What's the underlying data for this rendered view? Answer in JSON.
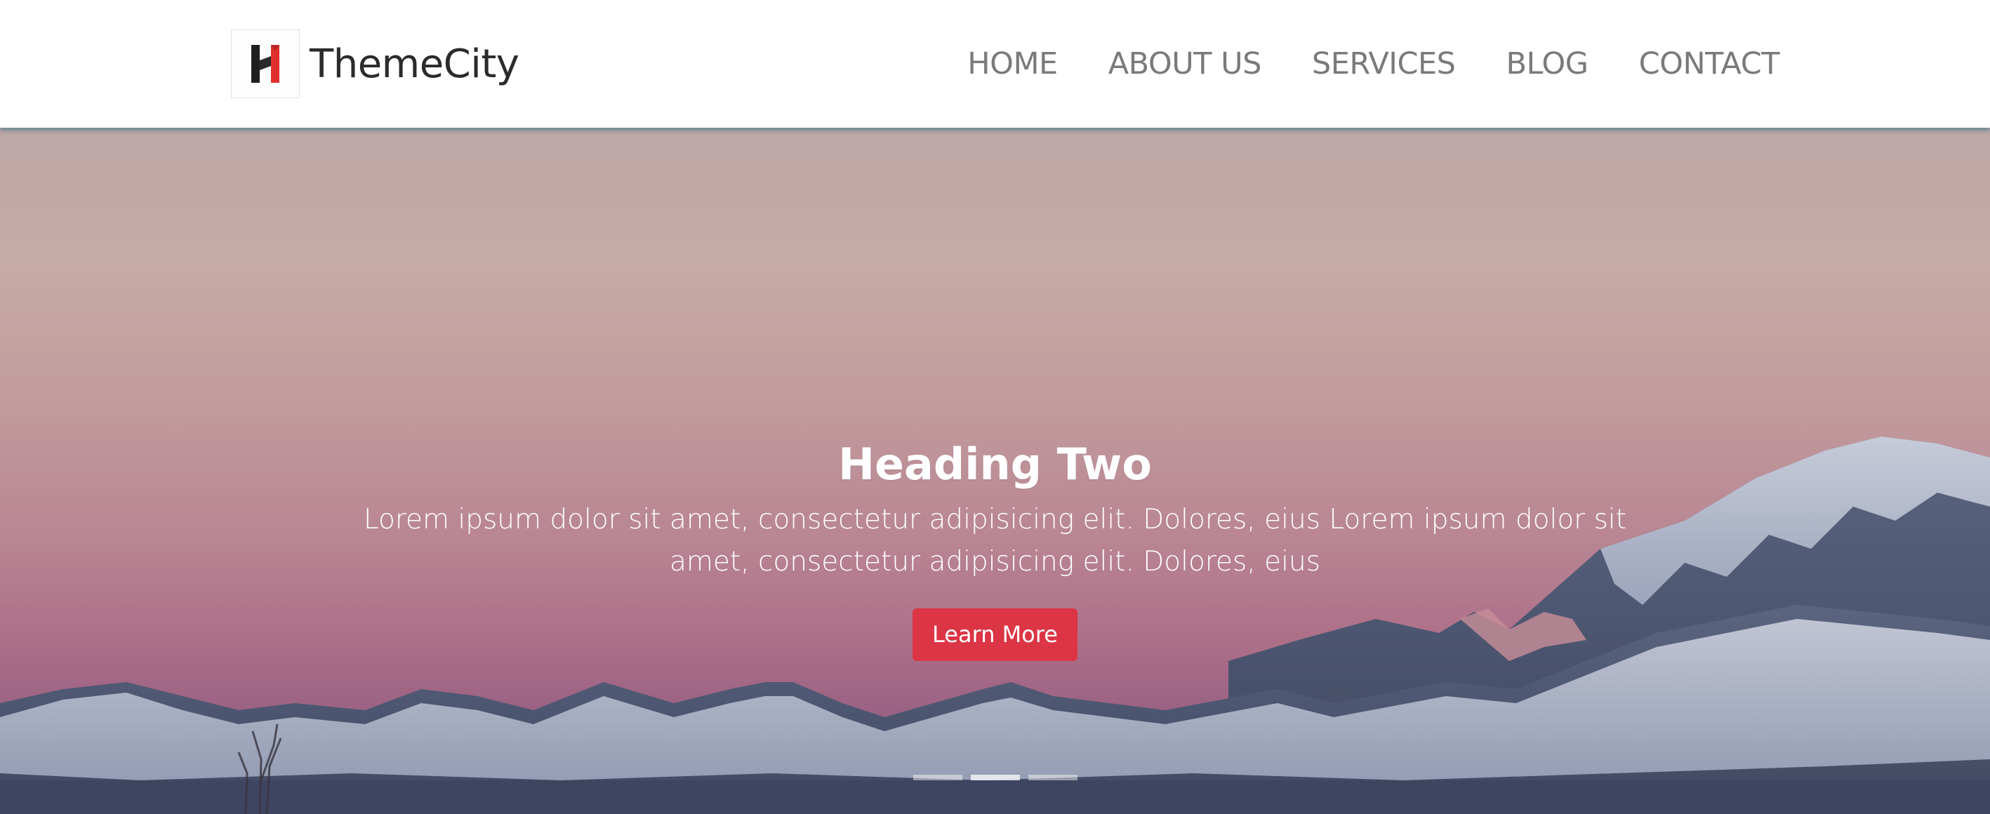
{
  "navbar": {
    "brand_name": "ThemeCity",
    "logo_icon": "themecity-logo",
    "links": [
      "HOME",
      "ABOUT US",
      "SERVICES",
      "BLOG",
      "CONTACT"
    ]
  },
  "carousel": {
    "heading": "Heading Two",
    "text": "Lorem ipsum dolor sit amet, consectetur adipisicing elit. Dolores, eius Lorem ipsum dolor sit amet, consectetur adipisicing elit. Dolores, eius",
    "button_label": "Learn More",
    "slide_count": 3,
    "active_slide": 2
  },
  "colors": {
    "accent": "#dc3545",
    "nav_text": "#7a7a7a",
    "brand_text": "#2b2b2b",
    "nav_shadow": "#2a6e82"
  }
}
